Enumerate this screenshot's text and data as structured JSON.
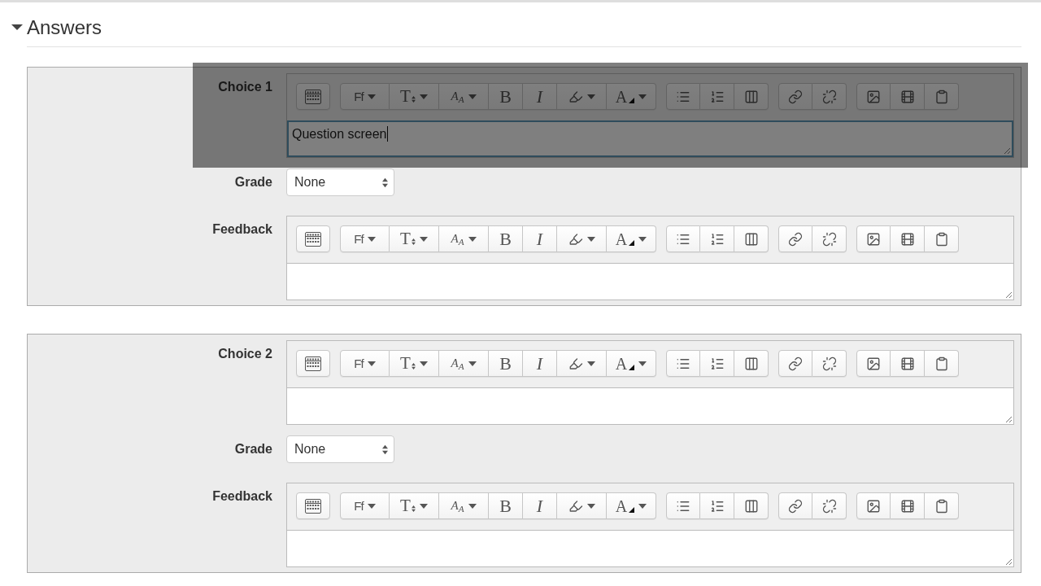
{
  "section": {
    "title": "Answers",
    "expanded": true
  },
  "choices": [
    {
      "label": "Choice 1",
      "highlighted": true,
      "editor": {
        "value": "Question screen",
        "focused": true,
        "toolbar": [
          [
            {
              "menu": false
            }
          ],
          [
            {
              "glyph": "Ff",
              "menu": true
            },
            {
              "glyph": "T",
              "menu": true
            },
            {
              "glyph": "A$_{A}$",
              "menu": true
            },
            {
              "glyph": "B",
              "menu": false
            },
            {
              "glyph": "I",
              "menu": false
            },
            {
              "menu": true
            },
            {
              "glyph": "A",
              "menu": true
            }
          ],
          [
            {
              "menu": false
            },
            {
              "menu": false
            },
            {
              "menu": false
            }
          ],
          [
            {
              "menu": false
            },
            {
              "menu": false
            }
          ],
          [
            {
              "menu": false
            },
            {
              "menu": false
            },
            {
              "menu": false
            }
          ]
        ]
      },
      "grade": {
        "label": "Grade",
        "value": "None"
      },
      "feedback": {
        "label": "Feedback",
        "editor": {
          "focused": false,
          "toolbar": [
            [
              {
                "menu": false
              }
            ],
            [
              {
                "glyph": "Ff",
                "menu": true
              },
              {
                "glyph": "T",
                "menu": true
              },
              {
                "glyph": "A$_{A}$",
                "menu": true
              },
              {
                "glyph": "B",
                "menu": false
              },
              {
                "glyph": "I",
                "menu": false
              },
              {
                "menu": true
              },
              {
                "glyph": "A",
                "menu": true
              }
            ],
            [
              {
                "menu": false
              },
              {
                "menu": false
              },
              {
                "menu": false
              }
            ],
            [
              {
                "menu": false
              },
              {
                "menu": false
              }
            ],
            [
              {
                "menu": false
              },
              {
                "menu": false
              },
              {
                "menu": false
              }
            ]
          ]
        }
      }
    },
    {
      "label": "Choice 2",
      "highlighted": false,
      "editor": {
        "focused": false,
        "toolbar": [
          [
            {
              "menu": false
            }
          ],
          [
            {
              "glyph": "Ff",
              "menu": true
            },
            {
              "glyph": "T",
              "menu": true
            },
            {
              "glyph": "A$_{A}$",
              "menu": true
            },
            {
              "glyph": "B",
              "menu": false
            },
            {
              "glyph": "I",
              "menu": false
            },
            {
              "menu": true
            },
            {
              "glyph": "A",
              "menu": true
            }
          ],
          [
            {
              "menu": false
            },
            {
              "menu": false
            },
            {
              "menu": false
            }
          ],
          [
            {
              "menu": false
            },
            {
              "menu": false
            }
          ],
          [
            {
              "menu": false
            },
            {
              "menu": false
            },
            {
              "menu": false
            }
          ]
        ]
      },
      "grade": {
        "label": "Grade",
        "value": "None"
      },
      "feedback": {
        "label": "Feedback",
        "editor": {
          "focused": false,
          "toolbar": [
            [
              {
                "menu": false
              }
            ],
            [
              {
                "glyph": "Ff",
                "menu": true
              },
              {
                "glyph": "T",
                "menu": true
              },
              {
                "glyph": "A$_{A}$",
                "menu": true
              },
              {
                "glyph": "B",
                "menu": false
              },
              {
                "glyph": "I",
                "menu": false
              },
              {
                "menu": true
              },
              {
                "glyph": "A",
                "menu": true
              }
            ],
            [
              {
                "menu": false
              },
              {
                "menu": false
              },
              {
                "menu": false
              }
            ],
            [
              {
                "menu": false
              },
              {
                "menu": false
              }
            ],
            [
              {
                "menu": false
              },
              {
                "menu": false
              },
              {
                "menu": false
              }
            ]
          ]
        }
      }
    }
  ]
}
